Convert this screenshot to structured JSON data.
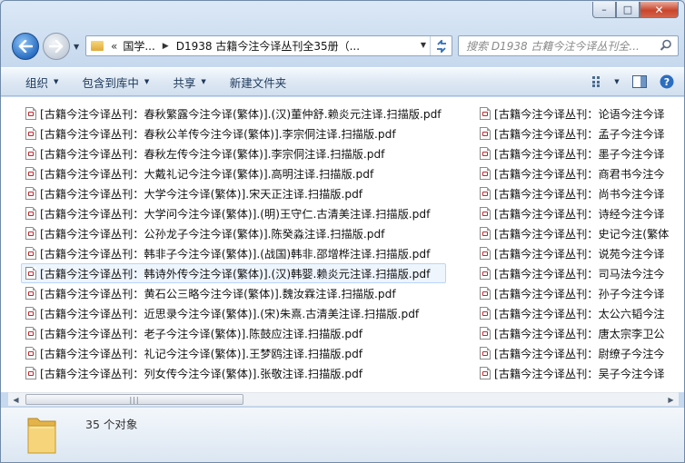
{
  "window": {
    "controls": {
      "minimize": "–",
      "maximize": "□",
      "close": "✕"
    }
  },
  "nav": {
    "back_icon": "back-arrow-icon",
    "forward_icon": "forward-arrow-icon",
    "address": {
      "prefix": "«",
      "segments": [
        "国学...",
        "D1938 古籍今注今译丛刊全35册（..."
      ]
    },
    "search_placeholder": "搜索 D1938 古籍今注今译丛刊全..."
  },
  "toolbar": {
    "organize": "组织",
    "include_library": "包含到库中",
    "share": "共享",
    "new_folder": "新建文件夹"
  },
  "files_col1": [
    "[古籍今注今译丛刊：春秋繁露今注今译(繁体)].(汉)董仲舒.赖炎元注译.扫描版.pdf",
    "[古籍今注今译丛刊：春秋公羊传今注今译(繁体)].李宗侗注译.扫描版.pdf",
    "[古籍今注今译丛刊：春秋左传今注今译(繁体)].李宗侗注译.扫描版.pdf",
    "[古籍今注今译丛刊：大戴礼记今注今译(繁体)].高明注译.扫描版.pdf",
    "[古籍今注今译丛刊：大学今注今译(繁体)].宋天正注译.扫描版.pdf",
    "[古籍今注今译丛刊：大学问今注今译(繁体)].(明)王守仁.古清美注译.扫描版.pdf",
    "[古籍今注今译丛刊：公孙龙子今注今译(繁体)].陈癸淼注译.扫描版.pdf",
    "[古籍今注今译丛刊：韩非子今注今译(繁体)].(战国)韩非.邵增桦注译.扫描版.pdf",
    "[古籍今注今译丛刊：韩诗外传今注今译(繁体)].(汉)韩婴.赖炎元注译.扫描版.pdf",
    "[古籍今注今译丛刊：黄石公三略今注今译(繁体)].魏汝霖注译.扫描版.pdf",
    "[古籍今注今译丛刊：近思录今注今译(繁体)].(宋)朱熹.古清美注译.扫描版.pdf",
    "[古籍今注今译丛刊：老子今注今译(繁体)].陈鼓应注译.扫描版.pdf",
    "[古籍今注今译丛刊：礼记今注今译(繁体)].王梦鸥注译.扫描版.pdf",
    "[古籍今注今译丛刊：列女传今注今译(繁体)].张敬注译.扫描版.pdf"
  ],
  "files_col2": [
    "[古籍今注今译丛刊：论语今注今译",
    "[古籍今注今译丛刊：孟子今注今译",
    "[古籍今注今译丛刊：墨子今注今译",
    "[古籍今注今译丛刊：商君书今注今",
    "[古籍今注今译丛刊：尚书今注今译",
    "[古籍今注今译丛刊：诗经今注今译",
    "[古籍今注今译丛刊：史记今注(繁体",
    "[古籍今注今译丛刊：说苑今注今译",
    "[古籍今注今译丛刊：司马法今注今",
    "[古籍今注今译丛刊：孙子今注今译",
    "[古籍今注今译丛刊：太公六韬今注",
    "[古籍今注今译丛刊：唐太宗李卫公",
    "[古籍今注今译丛刊：尉缭子今注今",
    "[古籍今注今译丛刊：吴子今注今译"
  ],
  "status": {
    "count": "35 个对象"
  },
  "colors": {
    "accent": "#1e395b",
    "hover_bg": "#eef5fd",
    "hover_border": "#b8d6fb"
  }
}
